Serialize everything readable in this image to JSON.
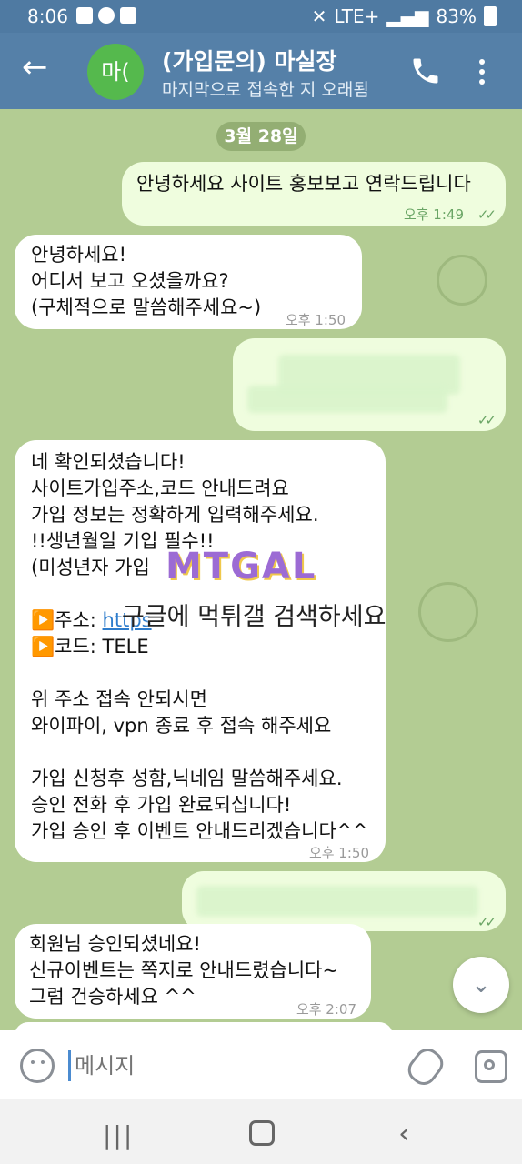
{
  "status_bar": {
    "time": "8:06",
    "network": "LTE+",
    "battery": "83%"
  },
  "header": {
    "back_icon": "arrow-left-icon",
    "avatar_text": "마(",
    "title": "(가입문의) 마실장",
    "subtitle": "마지막으로 접속한 지 오래됨",
    "call_icon": "phone-icon",
    "menu_icon": "more-vertical-icon",
    "accent": "#5580a8"
  },
  "chat": {
    "date": "3월 28일",
    "messages": [
      {
        "direction": "out",
        "text": "안녕하세요 사이트 홍보보고 연락드립니다",
        "time": "오후 1:49",
        "read": true
      },
      {
        "direction": "in",
        "text": "안녕하세요!\n어디서 보고 오셨을까요?\n(구체적으로 말씀해주세요~)",
        "time": "오후 1:50"
      },
      {
        "direction": "out",
        "text": "",
        "time": "",
        "read": true,
        "redacted": true
      },
      {
        "direction": "in",
        "lines": [
          "네 확인되셨습니다!",
          "사이트가입주소,코드 안내드려요",
          "가입 정보는 정확하게 입력해주세요.",
          "!!생년월일 기입 필수!!",
          "(미성년자 가입 ",
          "",
          "▶️주소: ",
          "▶️코드: TELE",
          "",
          "위 주소 접속 안되시면",
          "와이파이, vpn 종료 후 접속 해주세요",
          "",
          "가입 신청후 성함,닉네임 말씀해주세요.",
          "승인 전화 후 가입 완료되십니다!",
          "가입 승인 후 이벤트 안내드리겠습니다^^"
        ],
        "link_text": "https",
        "time": "오후 1:50"
      },
      {
        "direction": "out",
        "text": "",
        "time": "",
        "read": true,
        "redacted": true
      },
      {
        "direction": "in",
        "text": "회원님 승인되셨네요!\n신규이벤트는 쪽지로 안내드렸습니다~\n그럼 건승하세요 ^^",
        "time": "오후 2:07"
      }
    ],
    "watermark": "MTGAL",
    "watermark_caption": "구글에 먹튀갤 검색하세요"
  },
  "input_bar": {
    "placeholder": "메시지",
    "emoji_icon": "smile-icon",
    "attach_icon": "paperclip-icon",
    "camera_icon": "camera-icon"
  },
  "scroll_button_icon": "chevron-down-icon",
  "navigation": {
    "recent_icon": "recent-apps-icon",
    "home_icon": "home-icon",
    "back_icon": "back-icon"
  }
}
